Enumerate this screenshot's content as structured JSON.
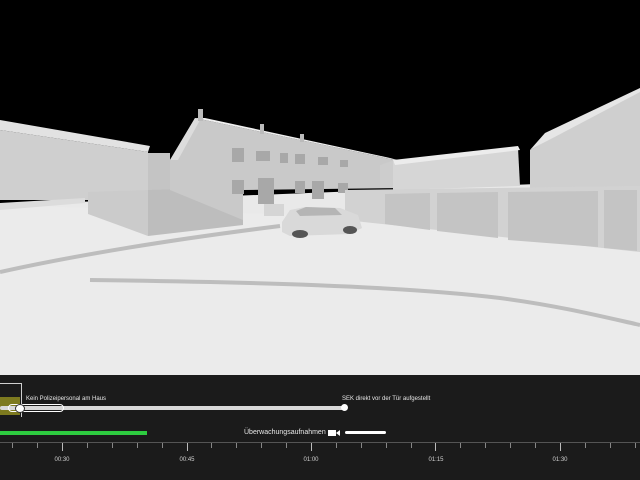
{
  "timeline": {
    "event_1": "Kein Polizeipersonal am Haus",
    "event_2": "SEK direkt vor der Tür aufgestellt",
    "track_label": "Überwachungsaufnahmen",
    "ticks": [
      "00:30",
      "00:45",
      "01:00",
      "01:15",
      "01:30"
    ],
    "playback_progress_percent": 23
  },
  "icons": {
    "camera": "video-camera-icon"
  },
  "colors": {
    "background": "#000000",
    "timeline_bg": "#1b1b1b",
    "progress": "#2ecc40",
    "marker": "#7d7a1f"
  }
}
